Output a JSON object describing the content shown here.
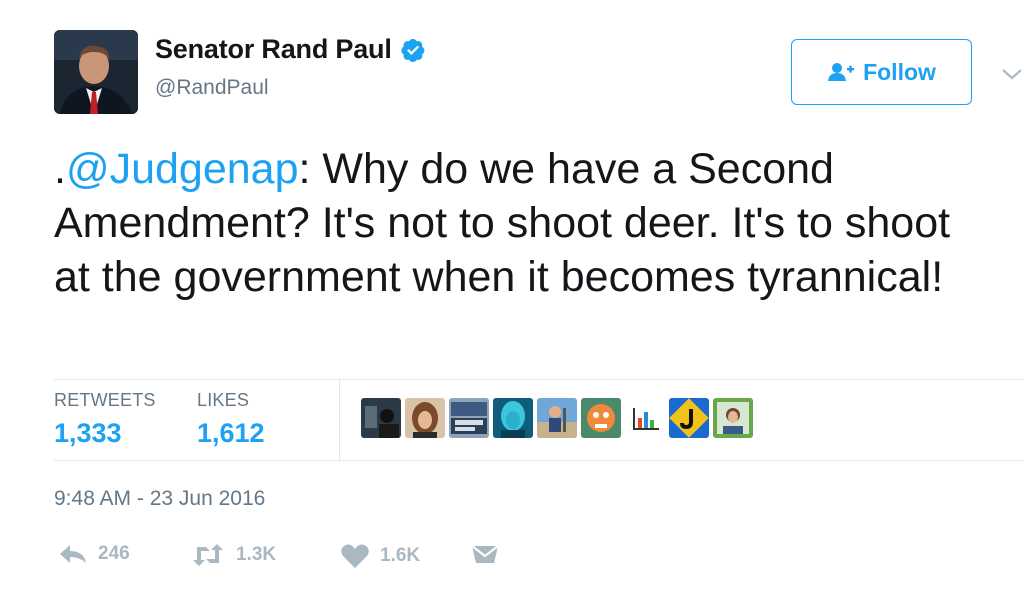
{
  "user": {
    "name": "Senator Rand Paul",
    "handle": "@RandPaul",
    "verified": true
  },
  "follow_button": {
    "label": "Follow",
    "icon": "add-user-icon"
  },
  "menu": {
    "icon": "chevron-down-icon"
  },
  "tweet": {
    "prefix": ".",
    "mention": "@Judgenap",
    "body": ": Why do we have a Second Amendment? It's not to shoot deer. It's to shoot at the government when it becomes tyrannical!"
  },
  "stats": {
    "retweets_label": "RETWEETS",
    "retweets_value": "1,333",
    "likes_label": "LIKES",
    "likes_value": "1,612"
  },
  "likers": [
    "liker-avatar-1",
    "liker-avatar-2",
    "liker-avatar-3",
    "liker-avatar-4",
    "liker-avatar-5",
    "liker-avatar-6",
    "liker-avatar-7",
    "liker-avatar-8",
    "liker-avatar-9"
  ],
  "timestamp": "9:48 AM - 23 Jun 2016",
  "actions": {
    "reply": "246",
    "retweet": "1.3K",
    "like": "1.6K"
  },
  "colors": {
    "accent": "#1da1f2",
    "muted": "#657786",
    "action": "#aab8c2",
    "text": "#14171a"
  }
}
